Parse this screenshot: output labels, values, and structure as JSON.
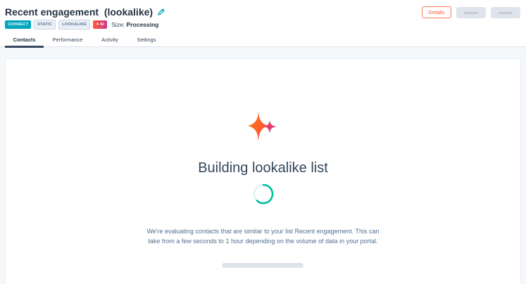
{
  "header": {
    "title": "Recent engagement  (lookalike)",
    "tags": {
      "connect": "CONNECT",
      "static": "STATIC",
      "lookalike": "LOOKALIKE",
      "ai": "AI"
    },
    "size_label": "Size:",
    "size_value": "Processing",
    "details_label": "Details"
  },
  "tabs": [
    {
      "label": "Contacts",
      "active": true
    },
    {
      "label": "Performance",
      "active": false
    },
    {
      "label": "Activity",
      "active": false
    },
    {
      "label": "Settings",
      "active": false
    }
  ],
  "main": {
    "heading": "Building lookalike list",
    "description": "We're evaluating contacts that are similar to your list Recent engagement. This can take from a few seconds to 1 hour depending on the volume of data in your portal."
  },
  "colors": {
    "accent": "#ff5c35",
    "teal": "#00a4bd",
    "spinner": "#00bda5"
  },
  "icons": {
    "edit": "pencil-icon",
    "sparkle": "sparkle-icon",
    "spinner": "loading-spinner-icon"
  }
}
